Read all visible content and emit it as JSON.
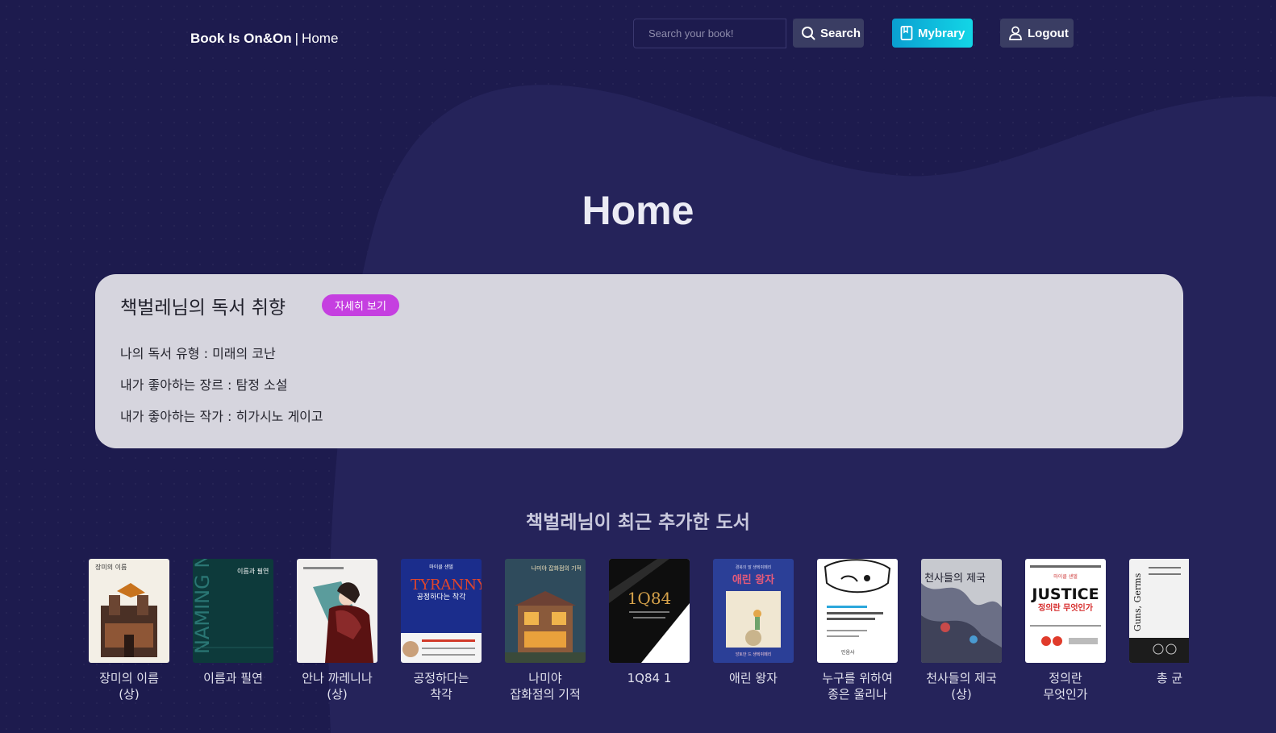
{
  "header": {
    "brand_name": "Book Is On&On",
    "brand_separator": "|",
    "brand_page": "Home",
    "search_placeholder": "Search your book!",
    "search_label": "Search",
    "mybrary_label": "Mybrary",
    "logout_label": "Logout"
  },
  "main": {
    "title": "Home",
    "profile": {
      "heading": "책벌레님의 독서 취향",
      "detail_label": "자세히 보기",
      "reading_type": {
        "label": "나의 독서 유형",
        "value": "미래의 코난"
      },
      "favorite_genre": {
        "label": "내가 좋아하는 장르",
        "value": "탐정 소설"
      },
      "favorite_author": {
        "label": "내가 좋아하는 작가",
        "value": "히가시노 게이고"
      }
    },
    "recent_title": "책벌레님이 최근 추가한 도서",
    "books": [
      {
        "title": "장미의 이름 (상)",
        "cover_text": "장미의 이름"
      },
      {
        "title": "이름과 필연",
        "cover_text": "NAMING NECESSITY"
      },
      {
        "title": "안나 까레니나 (상)",
        "cover_text": ""
      },
      {
        "title": "공정하다는 착각",
        "cover_text": "TYRANNY"
      },
      {
        "title": "나미야 잡화점의 기적",
        "cover_text": "나미야 잡화점의 기적"
      },
      {
        "title": "1Q84 1",
        "cover_text": "1Q84"
      },
      {
        "title": "애린 왕자",
        "cover_text": "애린 왕자"
      },
      {
        "title": "누구를 위하여 종은 울리나",
        "cover_text": ""
      },
      {
        "title": "천사들의 제국 (상)",
        "cover_text": "천사들의 제국"
      },
      {
        "title": "정의란 무엇인가",
        "cover_text": "JUSTICE"
      },
      {
        "title": "총 균",
        "cover_text": "Guns, Germs"
      }
    ]
  },
  "colors": {
    "background": "#1d1b4e",
    "card": "#d6d5de",
    "badge": "#c53fe0",
    "mybrary_start": "#0a9fd1",
    "mybrary_end": "#13d6e6",
    "dark_button": "#3a3d63"
  },
  "icons": {
    "search": "search-icon",
    "mybrary": "book-icon",
    "logout": "user-icon"
  }
}
